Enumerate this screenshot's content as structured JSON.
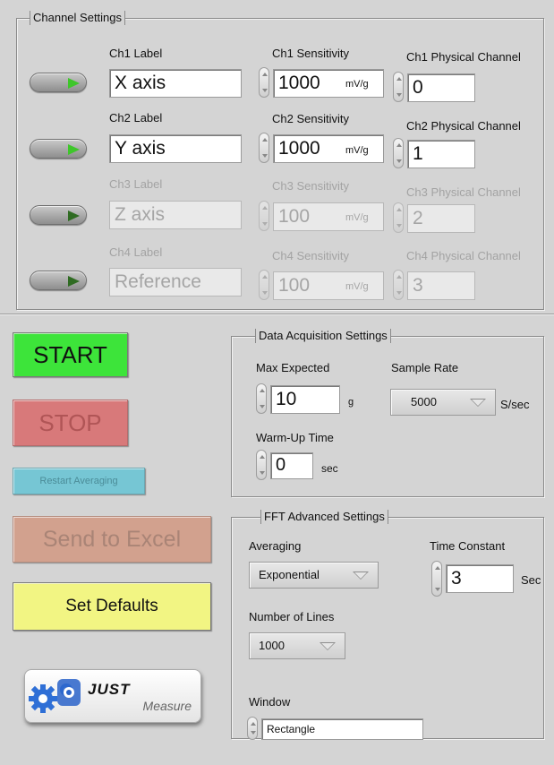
{
  "channel_settings": {
    "title": "Channel Settings",
    "channels": [
      {
        "label_caption": "Ch1 Label",
        "label_value": "X axis",
        "sens_caption": "Ch1 Sensitivity",
        "sens_value": "1000",
        "sens_unit": "mV/g",
        "phys_caption": "Ch1 Physical Channel",
        "phys_value": "0",
        "enabled": true
      },
      {
        "label_caption": "Ch2 Label",
        "label_value": "Y axis",
        "sens_caption": "Ch2 Sensitivity",
        "sens_value": "1000",
        "sens_unit": "mV/g",
        "phys_caption": "Ch2 Physical Channel",
        "phys_value": "1",
        "enabled": true
      },
      {
        "label_caption": "Ch3 Label",
        "label_value": "Z axis",
        "sens_caption": "Ch3 Sensitivity",
        "sens_value": "100",
        "sens_unit": "mV/g",
        "phys_caption": "Ch3 Physical Channel",
        "phys_value": "2",
        "enabled": false
      },
      {
        "label_caption": "Ch4 Label",
        "label_value": "Reference",
        "sens_caption": "Ch4 Sensitivity",
        "sens_value": "100",
        "sens_unit": "mV/g",
        "phys_caption": "Ch4 Physical Channel",
        "phys_value": "3",
        "enabled": false
      }
    ]
  },
  "buttons": {
    "start": "START",
    "stop": "STOP",
    "restart_averaging": "Restart Averaging",
    "send_to_excel": "Send to Excel",
    "set_defaults": "Set Defaults"
  },
  "daq": {
    "title": "Data Acquisition Settings",
    "max_expected_label": "Max Expected",
    "max_expected_value": "10",
    "max_expected_unit": "g",
    "sample_rate_label": "Sample Rate",
    "sample_rate_value": "5000",
    "sample_rate_unit": "S/sec",
    "warmup_label": "Warm-Up Time",
    "warmup_value": "0",
    "warmup_unit": "sec"
  },
  "fft": {
    "title": "FFT Advanced Settings",
    "averaging_label": "Averaging",
    "averaging_value": "Exponential",
    "time_constant_label": "Time Constant",
    "time_constant_value": "3",
    "time_constant_unit": "Sec",
    "lines_label": "Number of Lines",
    "lines_value": "1000",
    "window_label": "Window",
    "window_value": "Rectangle"
  },
  "logo": {
    "brand": "JUST",
    "product": "Measure"
  },
  "colors": {
    "start": "#3de43a",
    "stop": "#d8797a",
    "restart": "#76c6d4",
    "excel": "#d2a18e",
    "defaults": "#f2f583",
    "background": "#d4d4d4"
  }
}
